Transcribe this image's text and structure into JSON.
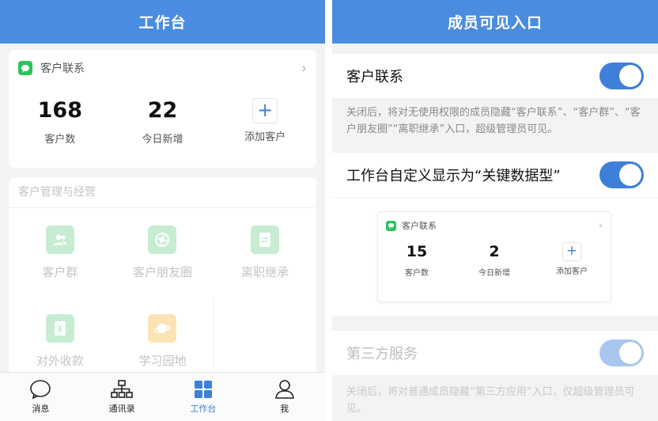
{
  "left": {
    "nav_title": "工作台",
    "customer_card": {
      "title": "客户联系",
      "stats": [
        {
          "value": "168",
          "label": "客户数"
        },
        {
          "value": "22",
          "label": "今日新增"
        }
      ],
      "add_symbol": "+",
      "add_label": "添加客户"
    },
    "manage": {
      "title": "客户管理与经营",
      "items": [
        {
          "label": "客户群",
          "icon": "people-icon"
        },
        {
          "label": "客户朋友圈",
          "icon": "aperture-icon"
        },
        {
          "label": "离职继承",
          "icon": "document-transfer-icon"
        },
        {
          "label": "对外收款",
          "icon": "yen-icon"
        },
        {
          "label": "学习园地",
          "icon": "planet-icon"
        }
      ]
    },
    "tabs": [
      {
        "label": "消息",
        "icon": "chat-bubble-icon"
      },
      {
        "label": "通讯录",
        "icon": "org-chart-icon"
      },
      {
        "label": "工作台",
        "icon": "grid-icon"
      },
      {
        "label": "我",
        "icon": "person-icon"
      }
    ]
  },
  "right": {
    "nav_title": "成员可见入口",
    "customer_contact": {
      "label": "客户联系",
      "enabled": true,
      "note": "关闭后，将对无使用权限的成员隐藏“客户联系”、“客户群”、“客户朋友圈”“离职继承”入口，超级管理员可见。"
    },
    "workbench_custom": {
      "label": "工作台自定义显示为“关键数据型”",
      "enabled": true
    },
    "preview": {
      "title": "客户联系",
      "stats": [
        {
          "value": "15",
          "label": "客户数"
        },
        {
          "value": "2",
          "label": "今日新增"
        }
      ],
      "add_symbol": "+",
      "add_label": "添加客户"
    },
    "third_party": {
      "label": "第三方服务",
      "enabled": true,
      "note": "关闭后，将对普通成员隐藏“第三方应用”入口，仅超级管理员可见。"
    }
  },
  "colors": {
    "nav_blue": "#4a8ce0",
    "accent": "#3d7fd9",
    "wechat_green": "#2ac55b",
    "muted_green": "#c6ecd2",
    "muted_yellow": "#fbe3b4"
  }
}
